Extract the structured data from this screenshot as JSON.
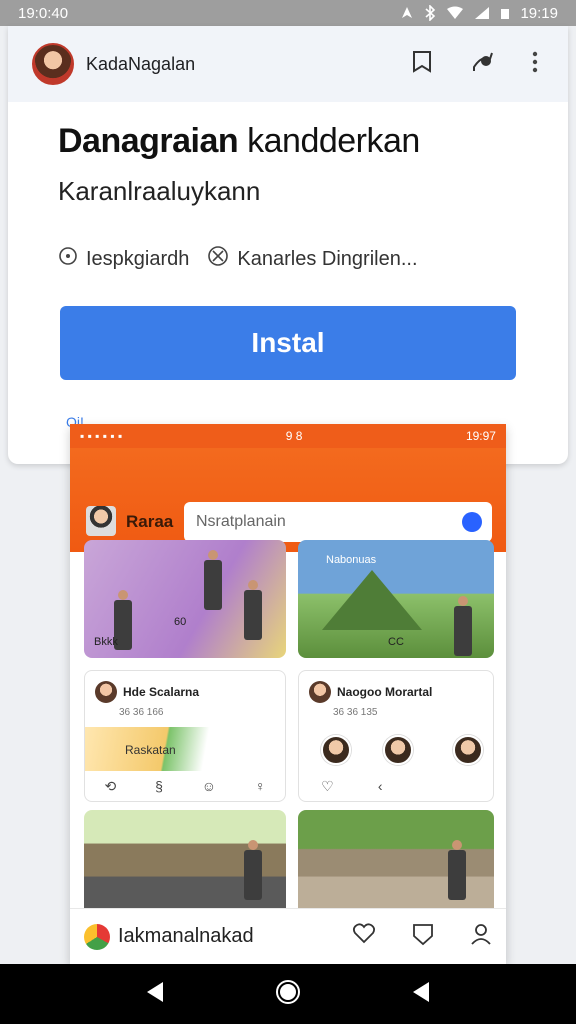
{
  "status_bar": {
    "time": "19:0:40",
    "right_time": "19:19"
  },
  "app_card": {
    "developer": "KadaNagalan",
    "title_bold": "Danagraian",
    "title_rest": "kandderkan",
    "subtitle": "Karanlraaluykann",
    "meta": [
      {
        "icon": "clock-icon",
        "text": "Iespkgiardh"
      },
      {
        "icon": "badge-icon",
        "text": "Kanarles Dingrilen..."
      }
    ],
    "install_label": "Instal",
    "tiny_link": "Oi!"
  },
  "screenshot": {
    "status_time_left": "9 8",
    "status_time_right": "19:97",
    "brand": "Raraa",
    "search_placeholder": "Nsratplanain",
    "tiles": [
      {
        "caption": "Bkkk"
      },
      {
        "caption": "Nabonuas"
      },
      {
        "caption": "Raskatan"
      },
      {
        "caption": ""
      }
    ],
    "panels": [
      {
        "name": "Hde Scalarna",
        "sub": "36  36  166"
      },
      {
        "name": "Naogoo Morartal",
        "sub": "36  36  135"
      }
    ],
    "tile_labels": [
      "60",
      "CC"
    ],
    "bottom_app": "Iakmanalnakad"
  },
  "colors": {
    "accent_blue": "#3b7de8",
    "brand_orange": "#f05a12"
  }
}
